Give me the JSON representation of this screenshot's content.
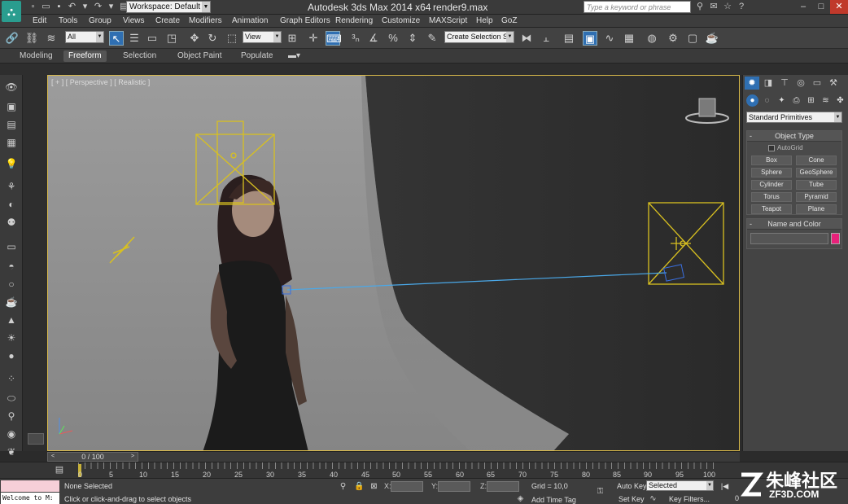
{
  "titlebar": {
    "app_title": "Autodesk 3ds Max  2014 x64",
    "file_name": "render9.max",
    "workspace": "Workspace: Default",
    "search_placeholder": "Type a keyword or phrase"
  },
  "menu": [
    "Edit",
    "Tools",
    "Group",
    "Views",
    "Create",
    "Modifiers",
    "Animation",
    "Graph Editors",
    "Rendering",
    "Customize",
    "MAXScript",
    "Help",
    "GoZ"
  ],
  "toolbar": {
    "selection_filter": "All",
    "ref_coord": "View",
    "named_selection": "Create Selection Se"
  },
  "ribbon": {
    "tabs": [
      "Modeling",
      "Freeform",
      "Selection",
      "Object Paint",
      "Populate"
    ],
    "active_tab": "Freeform"
  },
  "viewport": {
    "label": "[ + ] [ Perspective ] [ Realistic ]"
  },
  "command_panel": {
    "category": "Standard Primitives",
    "object_type_title": "Object Type",
    "autogrid_label": "AutoGrid",
    "object_buttons": [
      "Box",
      "Cone",
      "Sphere",
      "GeoSphere",
      "Cylinder",
      "Tube",
      "Torus",
      "Pyramid",
      "Teapot",
      "Plane"
    ],
    "name_color_title": "Name and Color",
    "object_color": "#e8217a"
  },
  "timeline": {
    "frame_counter": "0 / 100",
    "ticks": [
      "0",
      "5",
      "10",
      "15",
      "20",
      "25",
      "30",
      "35",
      "40",
      "45",
      "50",
      "55",
      "60",
      "65",
      "70",
      "75",
      "80",
      "85",
      "90",
      "95",
      "100"
    ]
  },
  "status": {
    "maxscript": "Welcome to M:",
    "selection_status": "None Selected",
    "prompt": "Click or click-and-drag to select objects",
    "x_label": "X:",
    "y_label": "Y:",
    "z_label": "Z:",
    "grid": "Grid = 10,0",
    "add_time_tag": "Add Time Tag",
    "auto_key": "Auto Key",
    "set_key": "Set Key",
    "key_mode": "Selected",
    "key_filters": "Key Filters...",
    "current_frame": "0"
  },
  "watermark": {
    "brand": "朱峰社区",
    "url": "ZF3D.COM"
  }
}
